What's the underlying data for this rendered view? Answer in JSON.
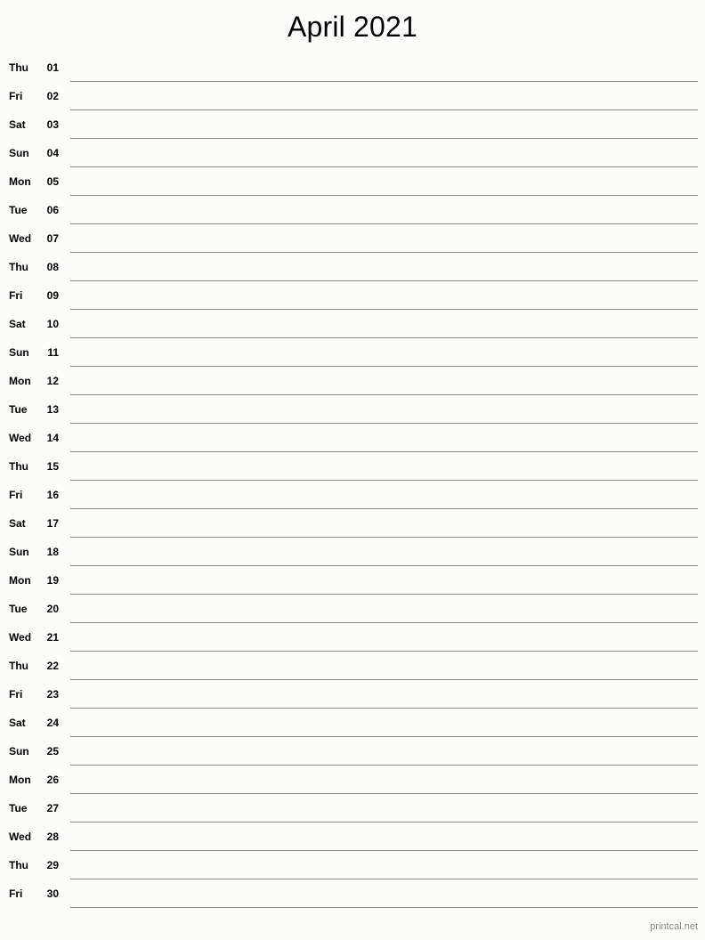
{
  "document": {
    "title": "April 2021",
    "month": "April",
    "year": "2021",
    "layout": "single-column-notes",
    "colors": {
      "background": "#fcfdf8",
      "text": "#000000",
      "rule_line": "#888a85",
      "footer_text": "#8a8a8a"
    }
  },
  "footer": {
    "credit": "printcal.net"
  },
  "days": [
    {
      "weekday": "Thu",
      "number": "01"
    },
    {
      "weekday": "Fri",
      "number": "02"
    },
    {
      "weekday": "Sat",
      "number": "03"
    },
    {
      "weekday": "Sun",
      "number": "04"
    },
    {
      "weekday": "Mon",
      "number": "05"
    },
    {
      "weekday": "Tue",
      "number": "06"
    },
    {
      "weekday": "Wed",
      "number": "07"
    },
    {
      "weekday": "Thu",
      "number": "08"
    },
    {
      "weekday": "Fri",
      "number": "09"
    },
    {
      "weekday": "Sat",
      "number": "10"
    },
    {
      "weekday": "Sun",
      "number": "11"
    },
    {
      "weekday": "Mon",
      "number": "12"
    },
    {
      "weekday": "Tue",
      "number": "13"
    },
    {
      "weekday": "Wed",
      "number": "14"
    },
    {
      "weekday": "Thu",
      "number": "15"
    },
    {
      "weekday": "Fri",
      "number": "16"
    },
    {
      "weekday": "Sat",
      "number": "17"
    },
    {
      "weekday": "Sun",
      "number": "18"
    },
    {
      "weekday": "Mon",
      "number": "19"
    },
    {
      "weekday": "Tue",
      "number": "20"
    },
    {
      "weekday": "Wed",
      "number": "21"
    },
    {
      "weekday": "Thu",
      "number": "22"
    },
    {
      "weekday": "Fri",
      "number": "23"
    },
    {
      "weekday": "Sat",
      "number": "24"
    },
    {
      "weekday": "Sun",
      "number": "25"
    },
    {
      "weekday": "Mon",
      "number": "26"
    },
    {
      "weekday": "Tue",
      "number": "27"
    },
    {
      "weekday": "Wed",
      "number": "28"
    },
    {
      "weekday": "Thu",
      "number": "29"
    },
    {
      "weekday": "Fri",
      "number": "30"
    }
  ]
}
